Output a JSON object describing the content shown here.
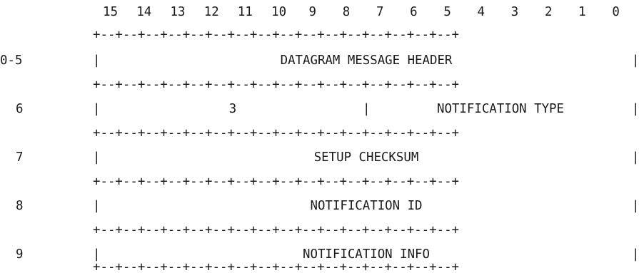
{
  "bit_header": [
    "15",
    "14",
    "13",
    "12",
    "11",
    "10",
    "9",
    "8",
    "7",
    "6",
    "5",
    "4",
    "3",
    "2",
    "1",
    "0"
  ],
  "separator": "+--+--+--+--+--+--+--+--+--+--+--+--+--+--+--+--+",
  "rows": [
    {
      "index": "0-5",
      "fields": [
        {
          "label": "DATAGRAM MESSAGE HEADER",
          "bits": 16
        }
      ]
    },
    {
      "index": "6",
      "fields": [
        {
          "label": "3",
          "bits": 8
        },
        {
          "label": "NOTIFICATION TYPE",
          "bits": 8
        }
      ]
    },
    {
      "index": "7",
      "fields": [
        {
          "label": "SETUP CHECKSUM",
          "bits": 16
        }
      ]
    },
    {
      "index": "8",
      "fields": [
        {
          "label": "NOTIFICATION ID",
          "bits": 16
        }
      ]
    },
    {
      "index": "9",
      "fields": [
        {
          "label": "NOTIFICATION INFO",
          "bits": 16
        }
      ]
    }
  ],
  "vertical_bar": "|"
}
